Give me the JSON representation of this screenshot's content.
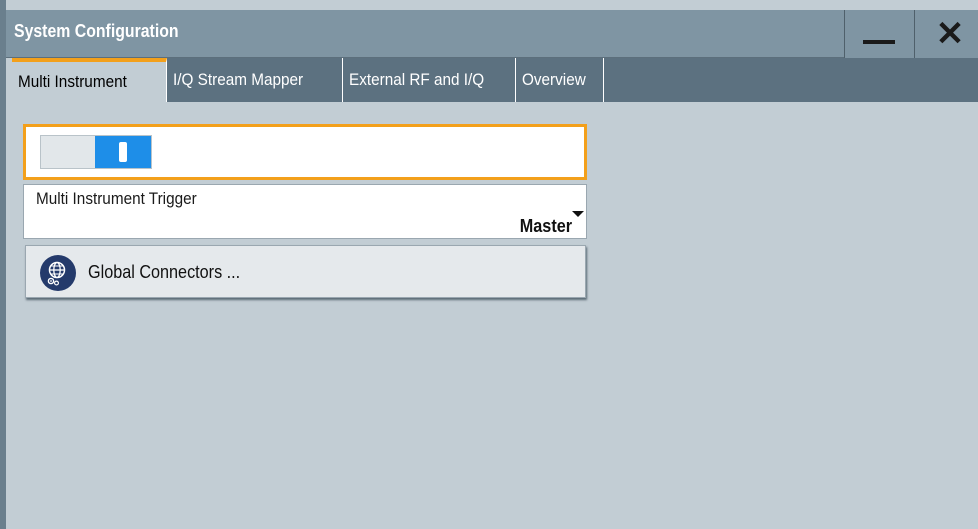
{
  "window": {
    "title": "System Configuration",
    "minimize_icon": "minimize-icon",
    "close_icon": "close-icon",
    "close_glyph": "✕"
  },
  "tabs": [
    {
      "label": "Multi Instrument",
      "active": true
    },
    {
      "label": "I/Q Stream Mapper",
      "active": false
    },
    {
      "label": "External RF and I/Q",
      "active": false
    },
    {
      "label": "Overview",
      "active": false
    }
  ],
  "multi_instrument": {
    "state_toggle": {
      "on": true
    },
    "trigger": {
      "label": "Multi Instrument Trigger",
      "value": "Master"
    },
    "global_connectors": {
      "label": "Global Connectors ...",
      "icon": "globe-gear-icon"
    }
  },
  "colors": {
    "accent": "#f3a01b",
    "toggle_on": "#1e8ee8",
    "titlebar": "#7f95a3",
    "tabbar": "#5c7180",
    "panel": "#c2cdd4"
  }
}
